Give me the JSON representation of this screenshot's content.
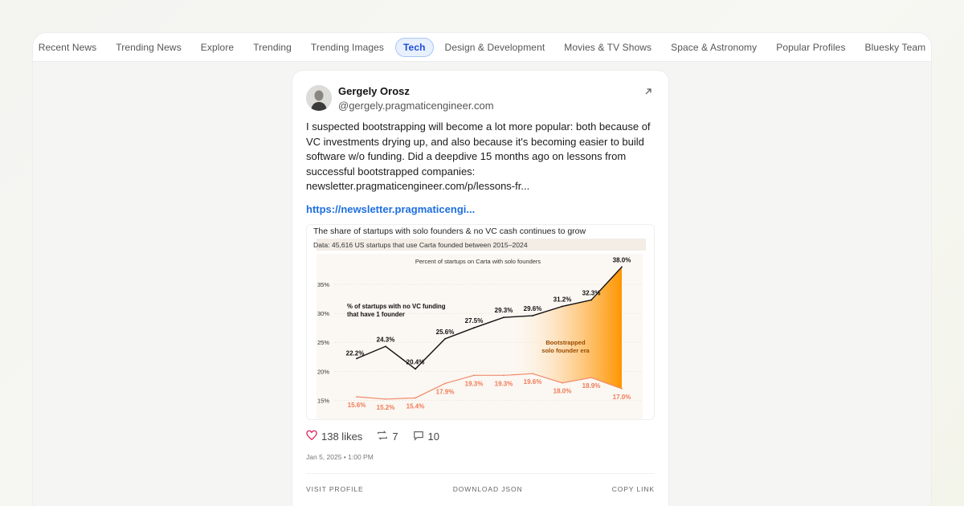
{
  "tabs": [
    {
      "label": "Recent News",
      "active": false
    },
    {
      "label": "Trending News",
      "active": false
    },
    {
      "label": "Explore",
      "active": false
    },
    {
      "label": "Trending",
      "active": false
    },
    {
      "label": "Trending Images",
      "active": false
    },
    {
      "label": "Tech",
      "active": true
    },
    {
      "label": "Design & Development",
      "active": false
    },
    {
      "label": "Movies & TV Shows",
      "active": false
    },
    {
      "label": "Space & Astronomy",
      "active": false
    },
    {
      "label": "Popular Profiles",
      "active": false
    },
    {
      "label": "Bluesky Team",
      "active": false
    }
  ],
  "post": {
    "author_name": "Gergely Orosz",
    "author_handle": "@gergely.pragmaticengineer.com",
    "text": "I suspected bootstrapping will become a lot more popular: both because of VC investments drying up, and also because it's becoming easier to build software w/o funding. Did a deepdive 15 months ago on lessons from successful bootstrapped companies: newsletter.pragmaticengineer.com/p/lessons-fr...",
    "link": "https://newsletter.pragmaticengi...",
    "likes": "138 likes",
    "reposts": "7",
    "replies": "10",
    "timestamp": "Jan 5, 2025 • 1:00 PM"
  },
  "actions": {
    "visit": "VISIT PROFILE",
    "download": "DOWNLOAD JSON",
    "copy": "COPY LINK"
  },
  "colors": {
    "accent": "#1d6fe0",
    "active_tab_bg": "#e8f0fd",
    "like_heart": "#e0245e",
    "series_no_vc": "#111111",
    "series_solo": "#f08a6b",
    "bootstrapped_fill": "#ff9900"
  },
  "chart_data": {
    "type": "line",
    "title": "The share of startups with solo founders & no VC cash continues to grow",
    "subtitle": "Data: 45,616 US startups that use Carta founded between 2015–2024",
    "panel_title": "Percent of startups on Carta with solo founders",
    "yticks": [
      "15%",
      "20%",
      "25%",
      "30%",
      "35%"
    ],
    "ylim": [
      12,
      40
    ],
    "grid": true,
    "annotation_series": "% of startups with no VC funding that have 1 founder",
    "annotation_era": "Bootstrapped solo founder era",
    "series": [
      {
        "name": "% of startups with no VC funding that have 1 founder",
        "values": [
          22.2,
          24.3,
          20.4,
          25.6,
          27.5,
          29.3,
          29.6,
          31.2,
          32.3,
          38.0
        ],
        "labels": [
          "22.2%",
          "24.3%",
          "20.4%",
          "25.6%",
          "27.5%",
          "29.3%",
          "29.6%",
          "31.2%",
          "32.3%",
          "38.0%"
        ]
      },
      {
        "values": [
          15.6,
          15.2,
          15.4,
          17.9,
          19.3,
          19.3,
          19.6,
          18.0,
          18.9,
          17.0
        ],
        "labels": [
          "15.6%",
          "15.2%",
          "15.4%",
          "17.9%",
          "19.3%",
          "19.3%",
          "19.6%",
          "18.0%",
          "18.9%",
          "17.0%"
        ]
      }
    ]
  }
}
